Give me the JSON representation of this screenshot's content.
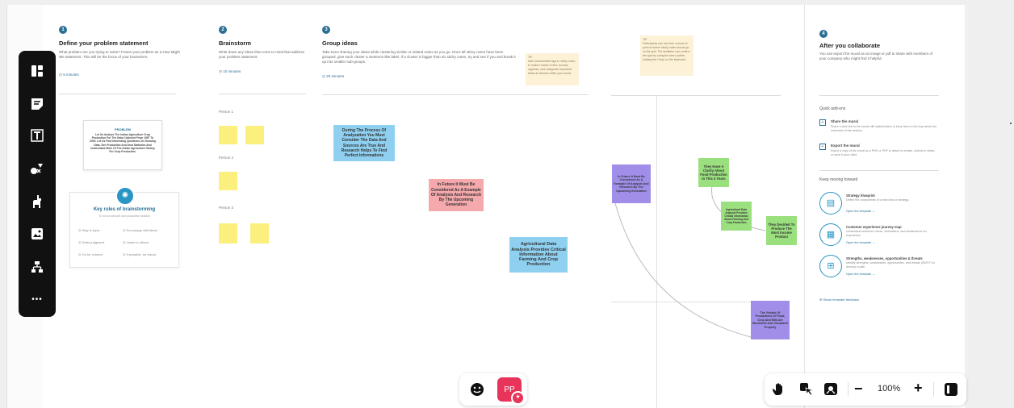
{
  "panels": {
    "define": {
      "num": "1",
      "title": "Define your problem statement",
      "desc": "What problem are you trying to solve? Frame your problem as a How Might We statement. This will be the focus of your brainstorm.",
      "duration": "5 minutes",
      "problem_heading": "PROBLEM",
      "problem_text": "Let Us Analyze The Indian Agriculture Crop Production For The Data Collected From 1997 To 2020. Let Us Find Interesting Questions On Growing Data, See Production And Area Statistics And Understand More Of The Indian Agriculture History For Crop Production.",
      "rules_title": "Key rules of brainstorming",
      "rules_sub": "To run an smooth and productive session",
      "rules": [
        "Stay in topic.",
        "Encourage wild ideas.",
        "Defer judgment.",
        "Listen to others.",
        "Go for volume.",
        "If possible, be visual."
      ]
    },
    "brainstorm": {
      "num": "2",
      "title": "Brainstorm",
      "desc": "Write down any ideas that come to mind that address your problem statement.",
      "duration": "10 minutes",
      "person1": "Person 1",
      "person2": "Person 2",
      "person3": "Person 3"
    },
    "group": {
      "num": "3",
      "title": "Group ideas",
      "desc": "Take turns sharing your ideas while clustering similar or related notes as you go. Once all sticky notes have been grouped, give each cluster a sentence-like label. If a cluster is bigger than six sticky notes, try and see if you and break it up into smaller sub-groups.",
      "duration": "20 minutes",
      "tip": "TIP\nAdd customizable tags to sticky notes to make it easier to find, browse, organize, and categorize important ideas as themes within your mural."
    },
    "prioritize": {
      "tip": "TIP\nParticipants can use their cursors to point at where sticky notes should go on the grid. The facilitator can confirm the spot by using the laser pointer holding the H key on the keyboard."
    },
    "after": {
      "num": "4",
      "title": "After you collaborate",
      "desc": "You can export the mural as an image or pdf to share with members of your company who might find it helpful.",
      "quick_addons": "Quick add-ons",
      "share_title": "Share the mural",
      "share_desc": "Share a view link to the mural with stakeholders to keep them in the loop about the outcomes of the session.",
      "export_title": "Export the mural",
      "export_desc": "Export a copy of the mural as a PNG or PDF to attach to emails, include in slides, or save in your drive.",
      "keep_moving": "Keep moving forward",
      "templates": [
        {
          "title": "Strategy blueprint",
          "desc": "Define the components of a new idea or strategy.",
          "link": "Open the template →"
        },
        {
          "title": "Customer experience journey map",
          "desc": "Understand customer needs, motivations, and obstacles for an experience.",
          "link": "Open the template →"
        },
        {
          "title": "Strengths, weaknesses, opportunities & threats",
          "desc": "Identify strengths, weaknesses, opportunities, and threats (SWOT) to develop a plan.",
          "link": "Open the template →"
        }
      ],
      "feedback": "Share template feedback"
    }
  },
  "stickies": {
    "blue1": "During The Process Of Analyzation You Must Consider The Data And Sources Are True And Research Helps To Find Perfect Informations",
    "pink1": "In Future It Must Be Considered As A Example Of Analysis And Research By The Upcoming Generation",
    "blue2": "Agricultural Data Analysis Provides Critical Information About Farming And Crop Production",
    "purple1": "In Future It Must Be Considered As A Example Of Analysis And Research By The Upcoming Generation",
    "green1": "They Have A Clarity About Food Production In This 4 Years",
    "green2": "Agricultural Data Analysis Provides Critical Information About Farming And Crop Production",
    "green3": "They Decided To Produce The Most Income Product",
    "purple2": "The Yielded Of Productions Of Food, Crop And Milk Are Monitored And Visualized Properly"
  },
  "bottom": {
    "avatar": "PP",
    "badge": "★",
    "zoom": "100%",
    "minus": "−",
    "plus": "+"
  },
  "toolbar": {
    "more": "•••"
  }
}
